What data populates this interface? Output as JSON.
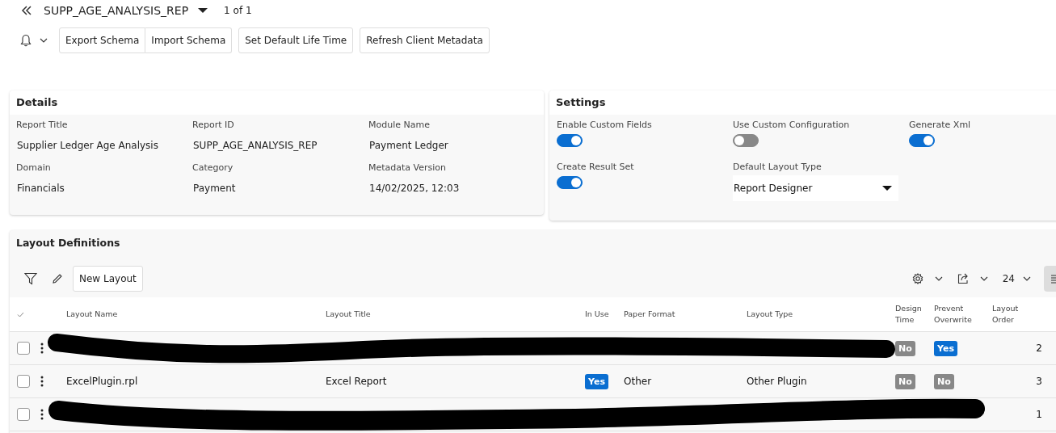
{
  "header": {
    "title": "SUPP_AGE_ANALYSIS_REP",
    "pager": "1 of 1"
  },
  "toolbar": {
    "buttons": [
      "Export Schema",
      "Import Schema",
      "Set Default Life Time",
      "Refresh Client Metadata"
    ]
  },
  "details": {
    "title": "Details",
    "fields": [
      {
        "label": "Report Title",
        "value": "Supplier Ledger Age Analysis"
      },
      {
        "label": "Report ID",
        "value": "SUPP_AGE_ANALYSIS_REP"
      },
      {
        "label": "Module Name",
        "value": "Payment Ledger"
      },
      {
        "label": "Domain",
        "value": "Financials"
      },
      {
        "label": "Category",
        "value": "Payment"
      },
      {
        "label": "Metadata Version",
        "value": "14/02/2025, 12:03"
      }
    ]
  },
  "settings": {
    "title": "Settings",
    "items": [
      {
        "kind": "toggle",
        "label": "Enable Custom Fields",
        "on": true
      },
      {
        "kind": "toggle",
        "label": "Use Custom Configuration",
        "on": false
      },
      {
        "kind": "toggle",
        "label": "Generate Xml",
        "on": true
      },
      {
        "kind": "toggle",
        "label": "Create Result Set",
        "on": true
      },
      {
        "kind": "select",
        "label": "Default Layout Type",
        "value": "Report Designer"
      }
    ]
  },
  "layout_definitions": {
    "title": "Layout Definitions",
    "new_button": "New Layout",
    "page_size": "24",
    "columns": [
      "Layout Name",
      "Layout Title",
      "In Use",
      "Paper Format",
      "Layout Type",
      "Design Time",
      "Prevent Overwrite",
      "Layout Order"
    ],
    "rows": [
      {
        "redacted": true,
        "checked": false,
        "design_time": {
          "text": "No",
          "on": false
        },
        "prevent_overwrite": {
          "text": "Yes",
          "on": true
        },
        "layout_order": "2"
      },
      {
        "redacted": false,
        "checked": false,
        "layout_name": "ExcelPlugin.rpl",
        "layout_title": "Excel Report",
        "in_use": {
          "text": "Yes",
          "on": true
        },
        "paper_format": "Other",
        "layout_type": "Other Plugin",
        "design_time": {
          "text": "No",
          "on": false
        },
        "prevent_overwrite": {
          "text": "No",
          "on": false
        },
        "layout_order": "3"
      },
      {
        "redacted": true,
        "checked": false,
        "layout_order": "1"
      }
    ]
  }
}
